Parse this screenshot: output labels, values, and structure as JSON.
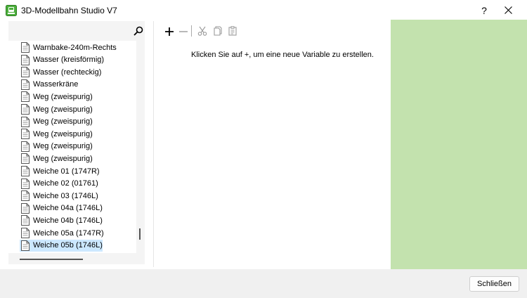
{
  "window": {
    "title": "3D-Modellbahn Studio V7",
    "help_label": "?"
  },
  "tree": {
    "items": [
      {
        "label": "Warnbake-240m-Rechts"
      },
      {
        "label": "Wasser (kreisförmig)"
      },
      {
        "label": "Wasser (rechteckig)"
      },
      {
        "label": "Wasserkräne"
      },
      {
        "label": "Weg (zweispurig)"
      },
      {
        "label": "Weg (zweispurig)"
      },
      {
        "label": "Weg (zweispurig)"
      },
      {
        "label": "Weg (zweispurig)"
      },
      {
        "label": "Weg (zweispurig)"
      },
      {
        "label": "Weg (zweispurig)"
      },
      {
        "label": "Weiche 01 (1747R)"
      },
      {
        "label": "Weiche 02 (01761)"
      },
      {
        "label": "Weiche 03 (1746L)"
      },
      {
        "label": "Weiche 04a (1746L)"
      },
      {
        "label": "Weiche 04b (1746L)"
      },
      {
        "label": "Weiche 05a (1747R)"
      },
      {
        "label": "Weiche 05b (1746L)"
      }
    ],
    "selected_index": 16
  },
  "toolbar": {
    "add_label": "+",
    "remove_label": "−"
  },
  "main": {
    "empty_message": "Klicken Sie auf +, um eine neue Variable zu erstellen."
  },
  "footer": {
    "close_label": "Schließen"
  },
  "colors": {
    "right_panel": "#c3e2ae",
    "selection": "#cce8ff",
    "app_icon": "#4caf3c"
  }
}
